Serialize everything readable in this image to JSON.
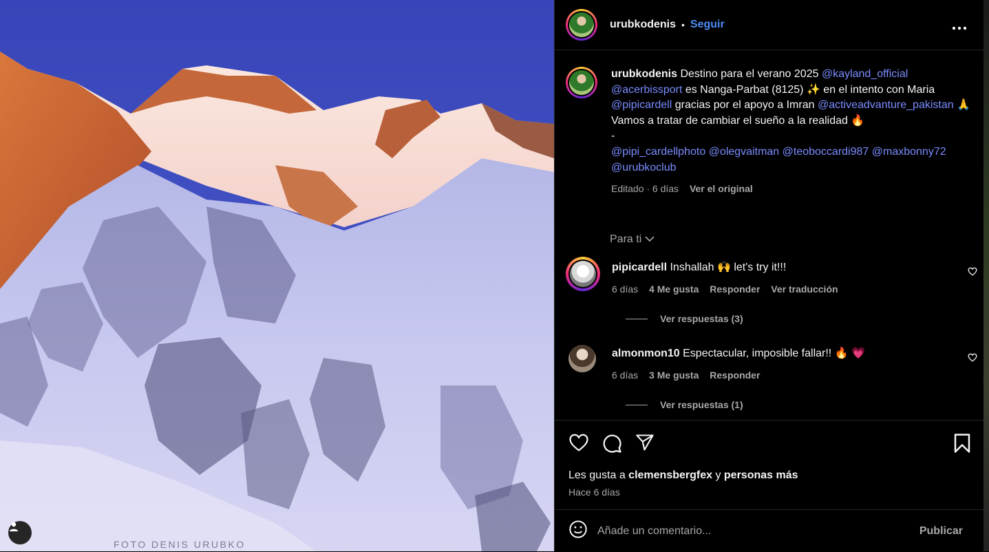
{
  "photo": {
    "watermark": "FOTO DENIS URUBKO"
  },
  "header": {
    "username": "urubkodenis",
    "separator": "•",
    "follow_label": "Seguir",
    "more_label": "•••"
  },
  "caption": {
    "username": "urubkodenis",
    "t1": " Destino para el verano 2025 ",
    "m1": "@kayland_official",
    "m2": "@acerbissport",
    "t2": " es Nanga-Parbat (8125) ✨  en el intento con Maria ",
    "m3": "@pipicardell",
    "t3": " gracias por el apoyo a Imran ",
    "m4": "@activeadvanture_pakistan",
    "t4": " 🙏 Vamos a tratar de cambiar el sueño a la realidad 🔥",
    "dash": "-",
    "m5": "@pipi_cardellphoto",
    "m6": "@olegvaitman",
    "m7": "@teoboccardi987",
    "m8": "@maxbonny72",
    "m9": "@urubkoclub",
    "edited": "Editado · 6 días",
    "see_original": "Ver el original"
  },
  "filter": {
    "label": "Para ti"
  },
  "comments": [
    {
      "username": "pipicardell",
      "text": " Inshallah 🙌  let's try it!!!",
      "time": "6 días",
      "likes": "4 Me gusta",
      "reply": "Responder",
      "translate": "Ver traducción",
      "replies": "Ver respuestas (3)"
    },
    {
      "username": "almonmon10",
      "text": " Espectacular, imposible fallar!! 🔥 💗",
      "time": "6 días",
      "likes": "3 Me gusta",
      "reply": "Responder",
      "replies": "Ver respuestas (1)"
    }
  ],
  "likes": {
    "prefix": "Les gusta a ",
    "user": "clemensbergfex",
    "mid": " y ",
    "rest": "personas más"
  },
  "time_ago": "Hace 6 días",
  "add_comment": {
    "placeholder": "Añade un comentario...",
    "publish": "Publicar"
  },
  "colors": {
    "mention": "#7b8cff",
    "follow": "#4c8df6",
    "muted": "#a8a8a8"
  },
  "icons": [
    "user-tag-icon",
    "more-icon",
    "chevron-down-icon",
    "heart-icon",
    "comment-icon",
    "share-icon",
    "bookmark-icon",
    "emoji-icon"
  ]
}
